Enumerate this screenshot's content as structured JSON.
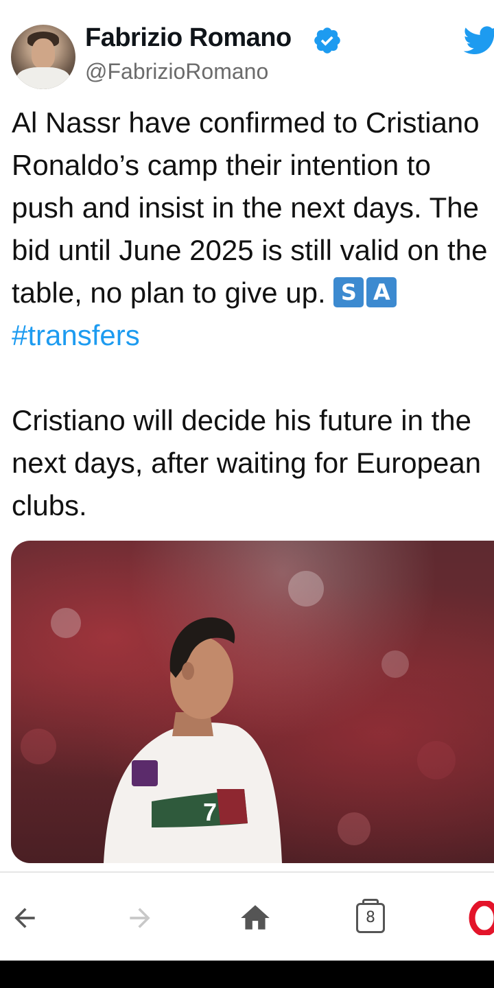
{
  "tweet": {
    "author_name": "Fabrizio Romano",
    "author_handle": "@FabrizioRomano",
    "verified_badge_color": "#1d9bf0",
    "paragraph1_text": "Al Nassr have confirmed to Cristiano Ronaldo’s camp their intention to push and insist in the next days. The bid until June 2025 is still valid on the table, no plan to give up.",
    "flag_letters": [
      "S",
      "A"
    ],
    "hashtag": "#transfers",
    "paragraph2_text": "Cristiano will decide his future in the next days, after waiting for European clubs.",
    "icons": {
      "avatar": "profile-photo",
      "verified": "verified-badge-icon",
      "brand": "twitter-bird-icon"
    }
  },
  "media": {
    "jersey_number": "7",
    "description_icon": "player-photo"
  },
  "browser_nav": {
    "tabs_count": "8",
    "icons": [
      "back-arrow-icon",
      "forward-arrow-icon",
      "home-icon",
      "tabs-icon",
      "opera-icon"
    ],
    "colors": {
      "active": "#555555",
      "disabled": "#c8c8c8",
      "opera": "#e3142a"
    }
  }
}
